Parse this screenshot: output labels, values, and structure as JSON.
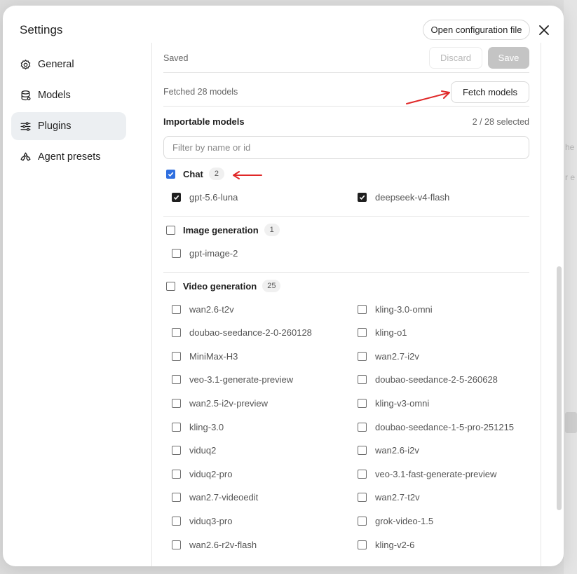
{
  "dialog": {
    "title": "Settings",
    "open_config_label": "Open configuration file"
  },
  "sidebar": {
    "items": [
      {
        "label": "General",
        "icon": "gear-icon",
        "active": false
      },
      {
        "label": "Models",
        "icon": "database-icon",
        "active": false
      },
      {
        "label": "Plugins",
        "icon": "sliders-icon",
        "active": true
      },
      {
        "label": "Agent presets",
        "icon": "agent-icon",
        "active": false
      }
    ]
  },
  "status": {
    "saved_label": "Saved",
    "discard_label": "Discard",
    "save_label": "Save"
  },
  "fetch": {
    "status_text": "Fetched 28 models",
    "button_label": "Fetch models"
  },
  "importable": {
    "heading": "Importable models",
    "selected_count": "2 / 28 selected",
    "filter_placeholder": "Filter by name or id"
  },
  "groups": {
    "chat": {
      "label": "Chat",
      "count": "2",
      "checked": true,
      "models": [
        {
          "name": "gpt-5.6-luna",
          "checked": true
        },
        {
          "name": "deepseek-v4-flash",
          "checked": true
        }
      ]
    },
    "image": {
      "label": "Image generation",
      "count": "1",
      "checked": false,
      "models": [
        {
          "name": "gpt-image-2",
          "checked": false
        }
      ]
    },
    "video": {
      "label": "Video generation",
      "count": "25",
      "checked": false,
      "models": [
        {
          "name": "wan2.6-t2v",
          "checked": false
        },
        {
          "name": "kling-3.0-omni",
          "checked": false
        },
        {
          "name": "doubao-seedance-2-0-260128",
          "checked": false
        },
        {
          "name": "kling-o1",
          "checked": false
        },
        {
          "name": "MiniMax-H3",
          "checked": false
        },
        {
          "name": "wan2.7-i2v",
          "checked": false
        },
        {
          "name": "veo-3.1-generate-preview",
          "checked": false
        },
        {
          "name": "doubao-seedance-2-5-260628",
          "checked": false
        },
        {
          "name": "wan2.5-i2v-preview",
          "checked": false
        },
        {
          "name": "kling-v3-omni",
          "checked": false
        },
        {
          "name": "kling-3.0",
          "checked": false
        },
        {
          "name": "doubao-seedance-1-5-pro-251215",
          "checked": false
        },
        {
          "name": "viduq2",
          "checked": false
        },
        {
          "name": "wan2.6-i2v",
          "checked": false
        },
        {
          "name": "viduq2-pro",
          "checked": false
        },
        {
          "name": "veo-3.1-fast-generate-preview",
          "checked": false
        },
        {
          "name": "wan2.7-videoedit",
          "checked": false
        },
        {
          "name": "wan2.7-t2v",
          "checked": false
        },
        {
          "name": "viduq3-pro",
          "checked": false
        },
        {
          "name": "grok-video-1.5",
          "checked": false
        },
        {
          "name": "wan2.6-r2v-flash",
          "checked": false
        },
        {
          "name": "kling-v2-6",
          "checked": false
        }
      ]
    }
  },
  "annotations": {
    "arrow_color": "#e02828"
  },
  "colors": {
    "accent_checkbox": "#2f6fe0",
    "active_nav_bg": "#eceff2"
  }
}
